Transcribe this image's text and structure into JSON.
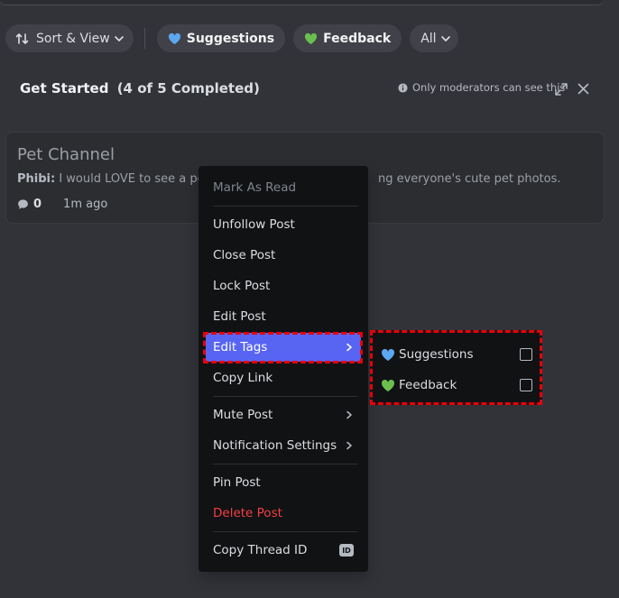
{
  "toolbar": {
    "sort_label": "Sort & View",
    "tags": [
      {
        "label": "Suggestions",
        "heart_color": "#5ca8f0"
      },
      {
        "label": "Feedback",
        "heart_color": "#6bbf4e"
      }
    ],
    "all_label": "All"
  },
  "get_started": {
    "title": "Get Started",
    "progress": "(4 of 5 Completed)",
    "moderator_note": "Only moderators can see this"
  },
  "post": {
    "title": "Pet Channel",
    "author": "Phibi:",
    "preview_left": " I would LOVE to see a pet c",
    "preview_right": "ng everyone's cute pet photos.",
    "comment_count": "0",
    "time": "1m ago"
  },
  "context_menu": {
    "mark_as_read": "Mark As Read",
    "unfollow": "Unfollow Post",
    "close": "Close Post",
    "lock": "Lock Post",
    "edit": "Edit Post",
    "edit_tags": "Edit Tags",
    "copy_link": "Copy Link",
    "mute": "Mute Post",
    "notifications": "Notification Settings",
    "pin": "Pin Post",
    "delete": "Delete Post",
    "copy_id": "Copy Thread ID",
    "id_badge": "ID"
  },
  "tags_submenu": [
    {
      "label": "Suggestions",
      "heart_color": "#5ca8f0",
      "checked": false
    },
    {
      "label": "Feedback",
      "heart_color": "#6bbf4e",
      "checked": false
    }
  ],
  "colors": {
    "accent": "#5865f2",
    "danger": "#f23f43",
    "highlight": "#e8000b"
  }
}
